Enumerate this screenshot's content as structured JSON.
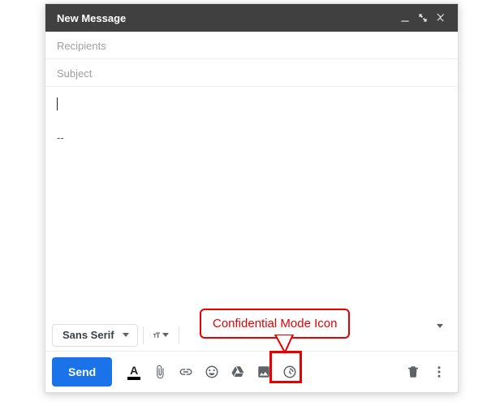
{
  "window": {
    "title": "New Message"
  },
  "fields": {
    "recipients_placeholder": "Recipients",
    "subject_placeholder": "Subject"
  },
  "body": {
    "signature_divider": "--"
  },
  "format_toolbar": {
    "font_family": "Sans Serif"
  },
  "actions": {
    "send_label": "Send"
  },
  "annotation": {
    "confidential_callout": "Confidential Mode Icon"
  }
}
